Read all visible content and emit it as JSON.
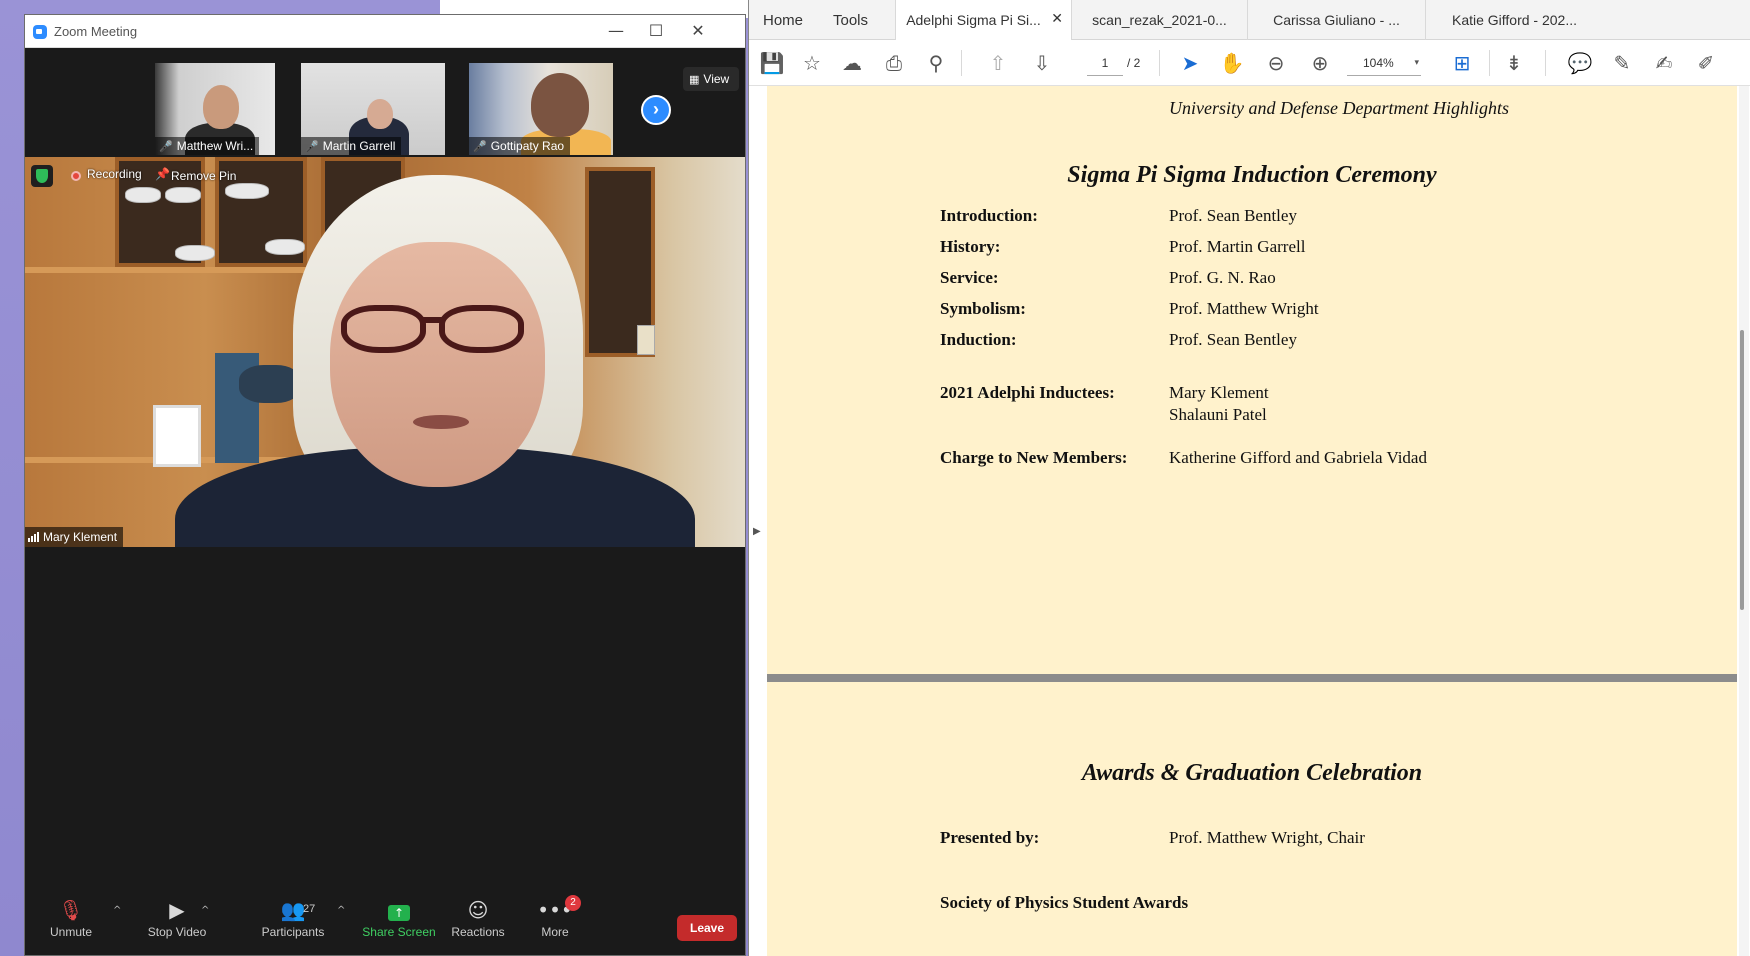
{
  "zoom": {
    "window_title": "Zoom Meeting",
    "view_label": "View",
    "thumbnails": [
      {
        "name": "Matthew Wri..."
      },
      {
        "name": "Martin Garrell"
      },
      {
        "name": "Gottipaty Rao"
      }
    ],
    "main_video": {
      "recording_label": "Recording",
      "remove_pin_label": "Remove Pin",
      "speaker_name": "Mary Klement"
    },
    "toolbar": {
      "unmute": "Unmute",
      "stop_video": "Stop Video",
      "participants": "Participants",
      "participants_count": "27",
      "share_screen": "Share Screen",
      "reactions": "Reactions",
      "more": "More",
      "more_badge": "2",
      "leave": "Leave"
    }
  },
  "pdf": {
    "nav_tabs": [
      "Home",
      "Tools"
    ],
    "doc_tabs": [
      {
        "label": "Adelphi Sigma Pi Si...",
        "active": true
      },
      {
        "label": "scan_rezak_2021-0...",
        "active": false
      },
      {
        "label": "Carissa Giuliano  - ...",
        "active": false
      },
      {
        "label": "Katie Gifford - 202...",
        "active": false
      }
    ],
    "current_page": "1",
    "total_pages": "/ 2",
    "zoom_level": "104%",
    "page1": {
      "header": "University and Defense Department Highlights",
      "section_title": "Sigma Pi Sigma Induction Ceremony",
      "rows": [
        {
          "label": "Introduction:",
          "value": "Prof. Sean Bentley"
        },
        {
          "label": "History:",
          "value": "Prof. Martin Garrell"
        },
        {
          "label": "Service:",
          "value": "Prof. G. N. Rao"
        },
        {
          "label": "Symbolism:",
          "value": "Prof. Matthew Wright"
        },
        {
          "label": "Induction:",
          "value": "Prof. Sean Bentley"
        }
      ],
      "inductees_label": "2021 Adelphi Inductees:",
      "inductees": [
        "Mary Klement",
        "Shalauni Patel"
      ],
      "charge_label": "Charge to New Members:",
      "charge_value": "Katherine Gifford and Gabriela Vidad"
    },
    "page2": {
      "section_title": "Awards & Graduation Celebration",
      "presented_label": "Presented by:",
      "presented_value": "Prof. Matthew Wright, Chair",
      "subsection": "Society of Physics Student Awards"
    }
  }
}
